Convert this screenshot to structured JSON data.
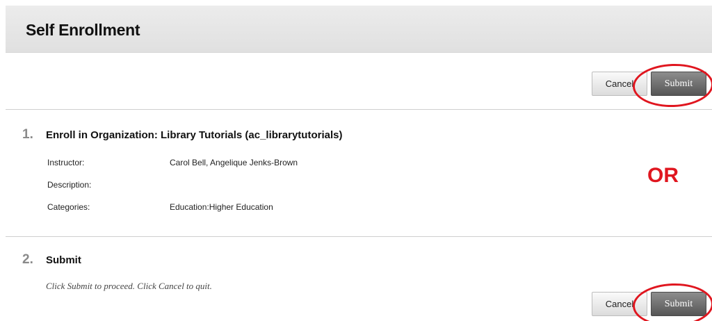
{
  "header": {
    "title": "Self Enrollment"
  },
  "actions": {
    "cancel_label": "Cancel",
    "submit_label": "Submit"
  },
  "annotation": {
    "or_text": "OR",
    "color": "#e0161f"
  },
  "step1": {
    "number": "1.",
    "title": "Enroll in Organization: Library Tutorials (ac_librarytutorials)",
    "fields": [
      {
        "label": "Instructor:",
        "value": "Carol Bell, Angelique Jenks-Brown"
      },
      {
        "label": "Description:",
        "value": ""
      },
      {
        "label": "Categories:",
        "value": "Education:Higher Education"
      }
    ]
  },
  "step2": {
    "number": "2.",
    "title": "Submit",
    "instructions": "Click Submit to proceed. Click Cancel to quit."
  }
}
